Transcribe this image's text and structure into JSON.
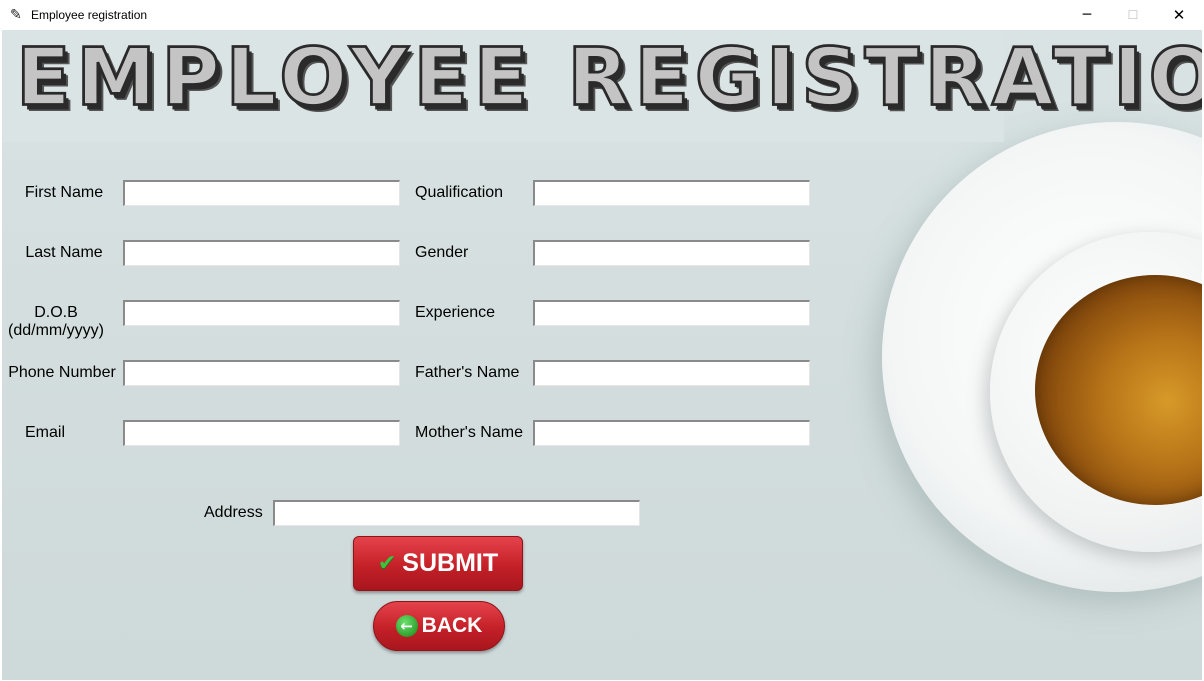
{
  "window": {
    "title": "Employee registration",
    "icon": "feather-icon",
    "minimize": "─",
    "maximize": "☐",
    "close": "✕"
  },
  "banner": {
    "text": "EMPLOYEE REGISTRATION"
  },
  "form": {
    "first_name_label": "First Name",
    "last_name_label": "Last Name",
    "dob_label_line1": "D.O.B",
    "dob_label_line2": "(dd/mm/yyyy)",
    "phone_label": "Phone Number",
    "email_label": "Email",
    "qualification_label": "Qualification",
    "gender_label": "Gender",
    "experience_label": "Experience",
    "father_label": "Father's Name",
    "mother_label": "Mother's Name",
    "address_label": "Address",
    "values": {
      "first_name": "",
      "last_name": "",
      "dob": "",
      "phone": "",
      "email": "",
      "qualification": "",
      "gender": "",
      "experience": "",
      "father": "",
      "mother": "",
      "address": ""
    }
  },
  "buttons": {
    "submit_label": "SUBMIT",
    "submit_icon": "check-icon",
    "back_label": "BACK",
    "back_icon": "back-arrow-icon"
  },
  "colors": {
    "button_red": "#c42028",
    "icon_green": "#3cc23c"
  }
}
